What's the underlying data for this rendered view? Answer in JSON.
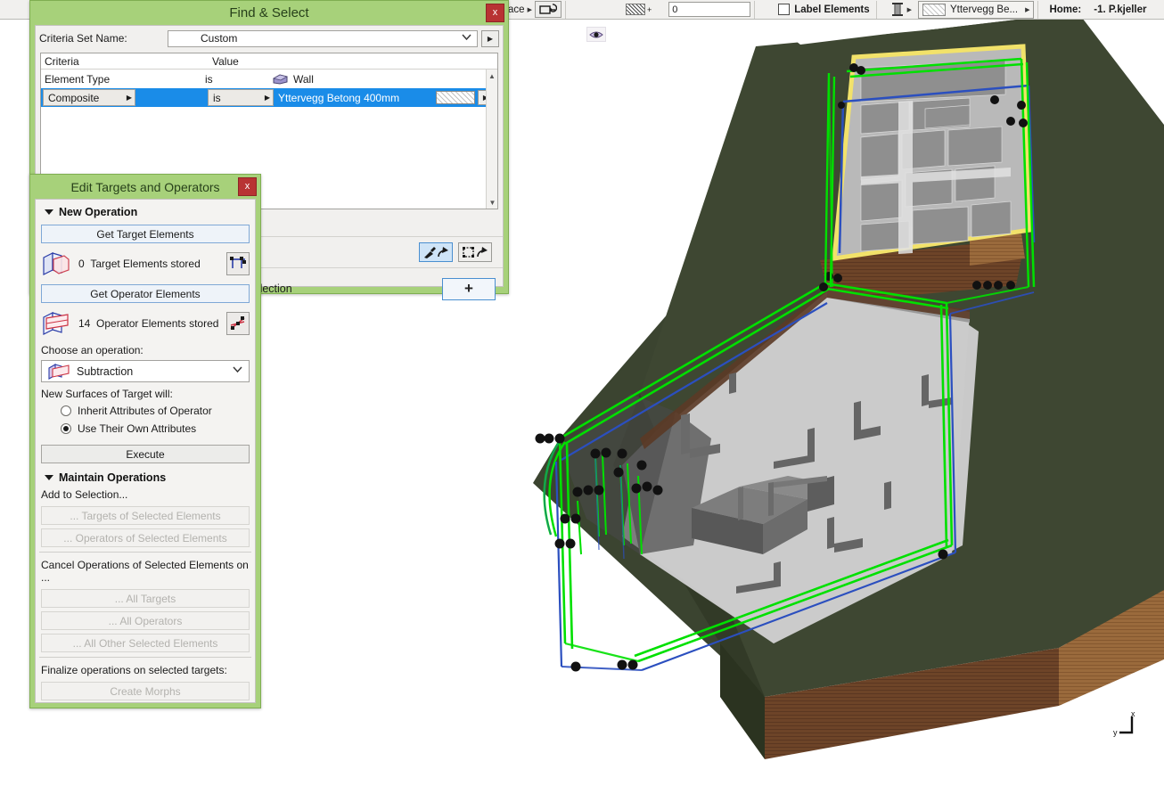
{
  "toolbar": {
    "face_label": "Face",
    "rotate_icon": "rotate-face-icon",
    "fill_swatch_icon": "hatch-fill-icon",
    "pen_value": "0",
    "label_elements": "Label Elements",
    "column_icon": "column-icon",
    "material_name": "Yttervegg Be...",
    "home_label": "Home:",
    "home_story": "-1. P.kjeller"
  },
  "find_select": {
    "title": "Find & Select",
    "close_label": "x",
    "criteria_set_label": "Criteria Set Name:",
    "criteria_set_value": "Custom",
    "popup_arrow": "▶",
    "columns": [
      "Criteria",
      "",
      "Value"
    ],
    "rows": [
      {
        "criteria": "Element Type",
        "operator": "is",
        "value": "Wall",
        "icon": "wall-element-icon",
        "selected": false,
        "combo": false
      },
      {
        "criteria": "Composite",
        "operator": "is",
        "value": "Yttervegg Betong 400mm",
        "icon": "composite-swatch-icon",
        "selected": true,
        "combo": true
      }
    ],
    "pick_icon": "eyedropper-pick-icon",
    "marquee_icon": "marquee-pick-icon",
    "minus_label": "–",
    "selection_label": "Selection",
    "plus_label": "+"
  },
  "edit_targets": {
    "title": "Edit Targets and Operators",
    "close_label": "x",
    "new_operation": "New Operation",
    "get_target_elements": "Get Target Elements",
    "target_count": "0",
    "target_stored_label": "Target Elements stored",
    "target_icon": "target-solid-icon",
    "target_action_icon": "select-targets-icon",
    "get_operator_elements": "Get Operator Elements",
    "operator_count": "14",
    "operator_stored_label": "Operator Elements stored",
    "operator_icon": "operator-solid-icon",
    "operator_action_icon": "select-operators-icon",
    "choose_operation_label": "Choose an operation:",
    "operation_value": "Subtraction",
    "operation_icon": "subtraction-icon",
    "new_surfaces_label": "New Surfaces of Target will:",
    "radio_inherit": "Inherit Attributes of Operator",
    "radio_own": "Use Their Own Attributes",
    "radio_selected": "own",
    "execute": "Execute",
    "maintain_operations": "Maintain Operations",
    "add_to_selection": "Add to Selection...",
    "targets_of_selected": "... Targets of Selected Elements",
    "operators_of_selected": "... Operators of Selected Elements",
    "cancel_operations_label": "Cancel Operations of Selected Elements on ...",
    "all_targets": "... All Targets",
    "all_operators": "... All Operators",
    "all_other_selected": "... All Other Selected Elements",
    "finalize_label": "Finalize operations on selected targets:",
    "create_morphs": "Create Morphs"
  },
  "viewport": {
    "eye_icon": "eye-visibility-icon",
    "axis_x": "x",
    "axis_y": "y",
    "colors": {
      "terrain_top": "#3c4530",
      "terrain_side": "#5a4030",
      "terrain_side_dark": "#4a3326",
      "slab": "#c9c9c9",
      "wall_gray": "#8d8d8d",
      "wall_dark": "#555555",
      "selection_green": "#00e000",
      "guide_blue": "#2b4fbf",
      "highlight_yellow": "#f0e68c",
      "wood": "#8a5a32",
      "background": "#ffffff"
    }
  }
}
